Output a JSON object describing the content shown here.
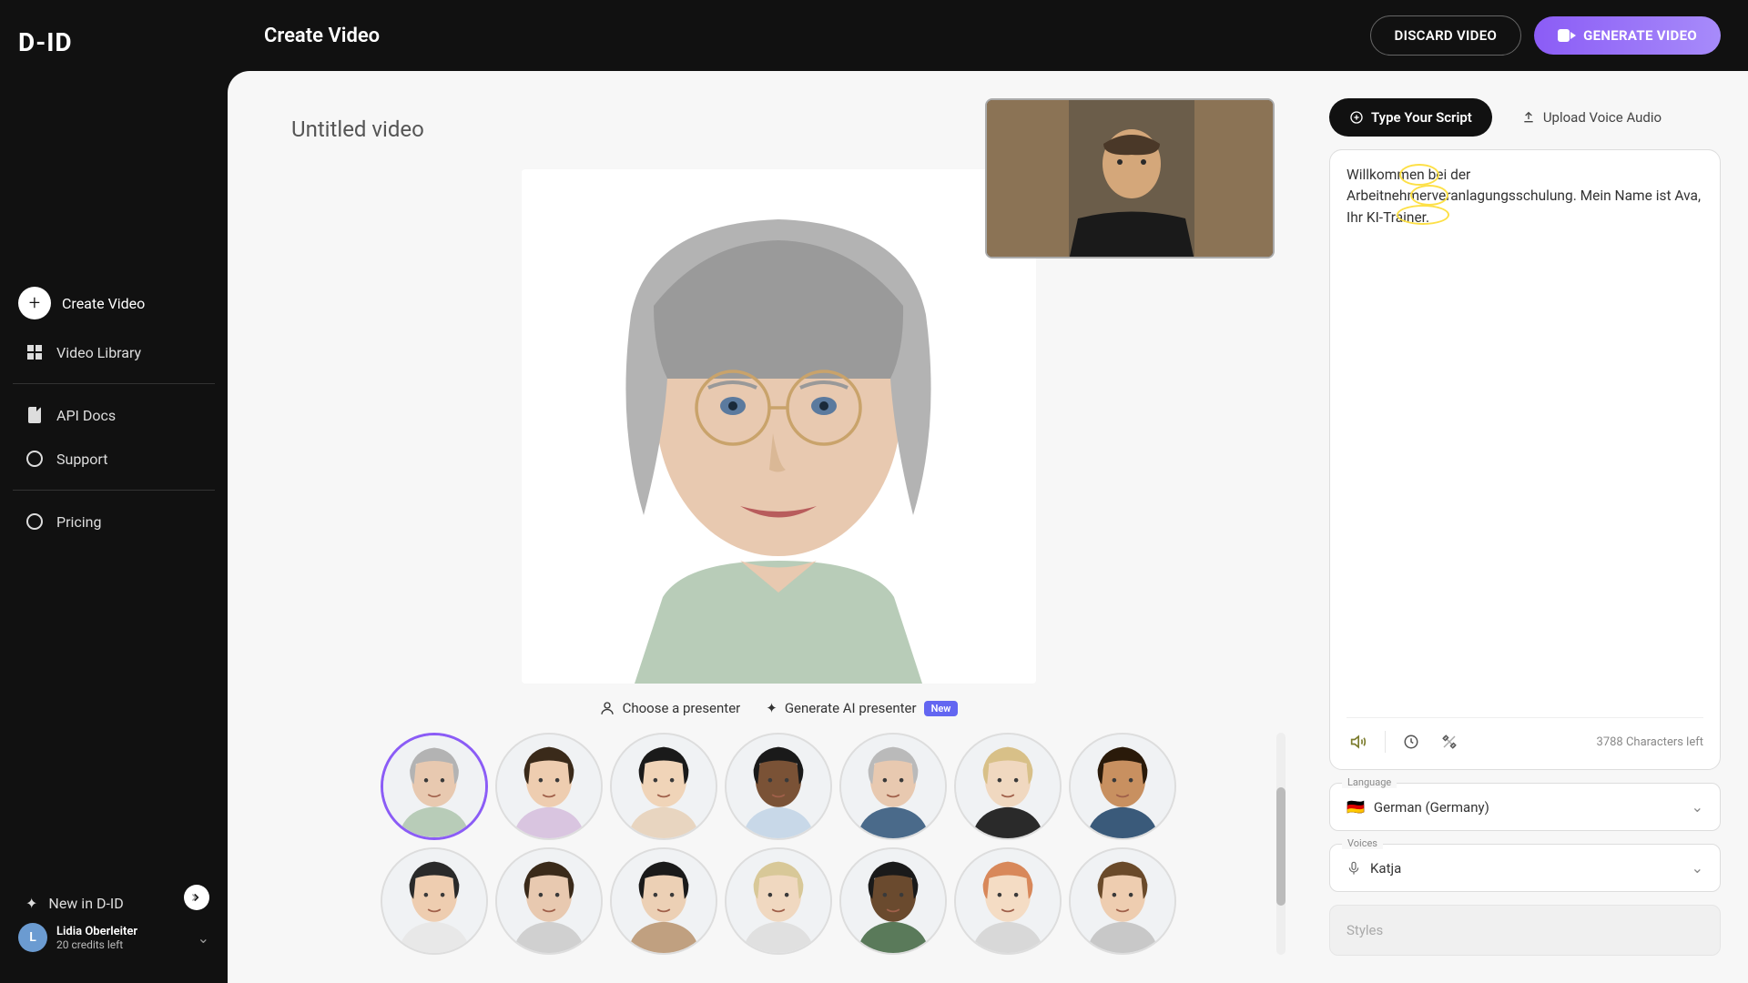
{
  "logo": "D-ID",
  "page_title": "Create Video",
  "header": {
    "discard": "DISCARD VIDEO",
    "generate": "GENERATE VIDEO"
  },
  "sidebar": {
    "create": "Create Video",
    "library": "Video Library",
    "api_docs": "API Docs",
    "support": "Support",
    "pricing": "Pricing",
    "new_in": "New in D-ID"
  },
  "user": {
    "initial": "L",
    "name": "Lidia Oberleiter",
    "credits": "20 credits left"
  },
  "video": {
    "title": "Untitled video",
    "choose_presenter": "Choose a presenter",
    "generate_ai": "Generate AI presenter",
    "new_badge": "New"
  },
  "script": {
    "tab_type": "Type Your Script",
    "tab_upload": "Upload Voice Audio",
    "text": "Willkommen bei der Arbeitnehmerveranlagungsschulung. Mein Name ist Ava, Ihr KI-Trainer.",
    "chars_left": "3788 Characters left"
  },
  "language": {
    "label": "Language",
    "flag": "🇩🇪",
    "value": "German (Germany)"
  },
  "voices": {
    "label": "Voices",
    "value": "Katja"
  },
  "styles": {
    "label": "Styles"
  }
}
